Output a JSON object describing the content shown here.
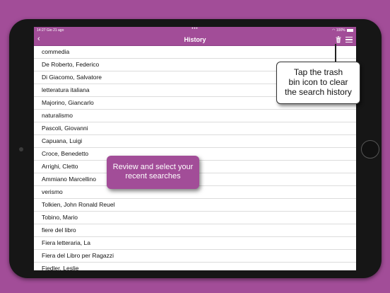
{
  "statusbar": {
    "time_date": "14:27  Gio 21 ago",
    "center_dots": "•••",
    "battery": "100%"
  },
  "navbar": {
    "back_icon": "‹",
    "title": "History",
    "trash_icon": "trash-icon",
    "menu_icon": "hamburger-menu-icon"
  },
  "history": [
    "commedia",
    "De Roberto, Federico",
    "Di Giacomo, Salvatore",
    "letteratura italiana",
    "Majorino, Giancarlo",
    "naturalismo",
    "Pascoli, Giovanni",
    "Capuana, Luigi",
    "Croce, Benedetto",
    "Arrighi, Cletto",
    "Ammiano Marcellino",
    "verismo",
    "Tolkien, John Ronald Reuel",
    "Tobino, Mario",
    "fiere del libro",
    "Fiera letteraria, La",
    "Fiera del Libro per Ragazzi",
    "Fiedler, Leslie"
  ],
  "callouts": {
    "trash": [
      "Tap the trash",
      "bin icon to clear",
      "the search history"
    ],
    "review": [
      "Review and select your",
      "recent searches"
    ]
  },
  "colors": {
    "accent": "#a24d98",
    "background": "#a24d98",
    "device": "#161616"
  }
}
